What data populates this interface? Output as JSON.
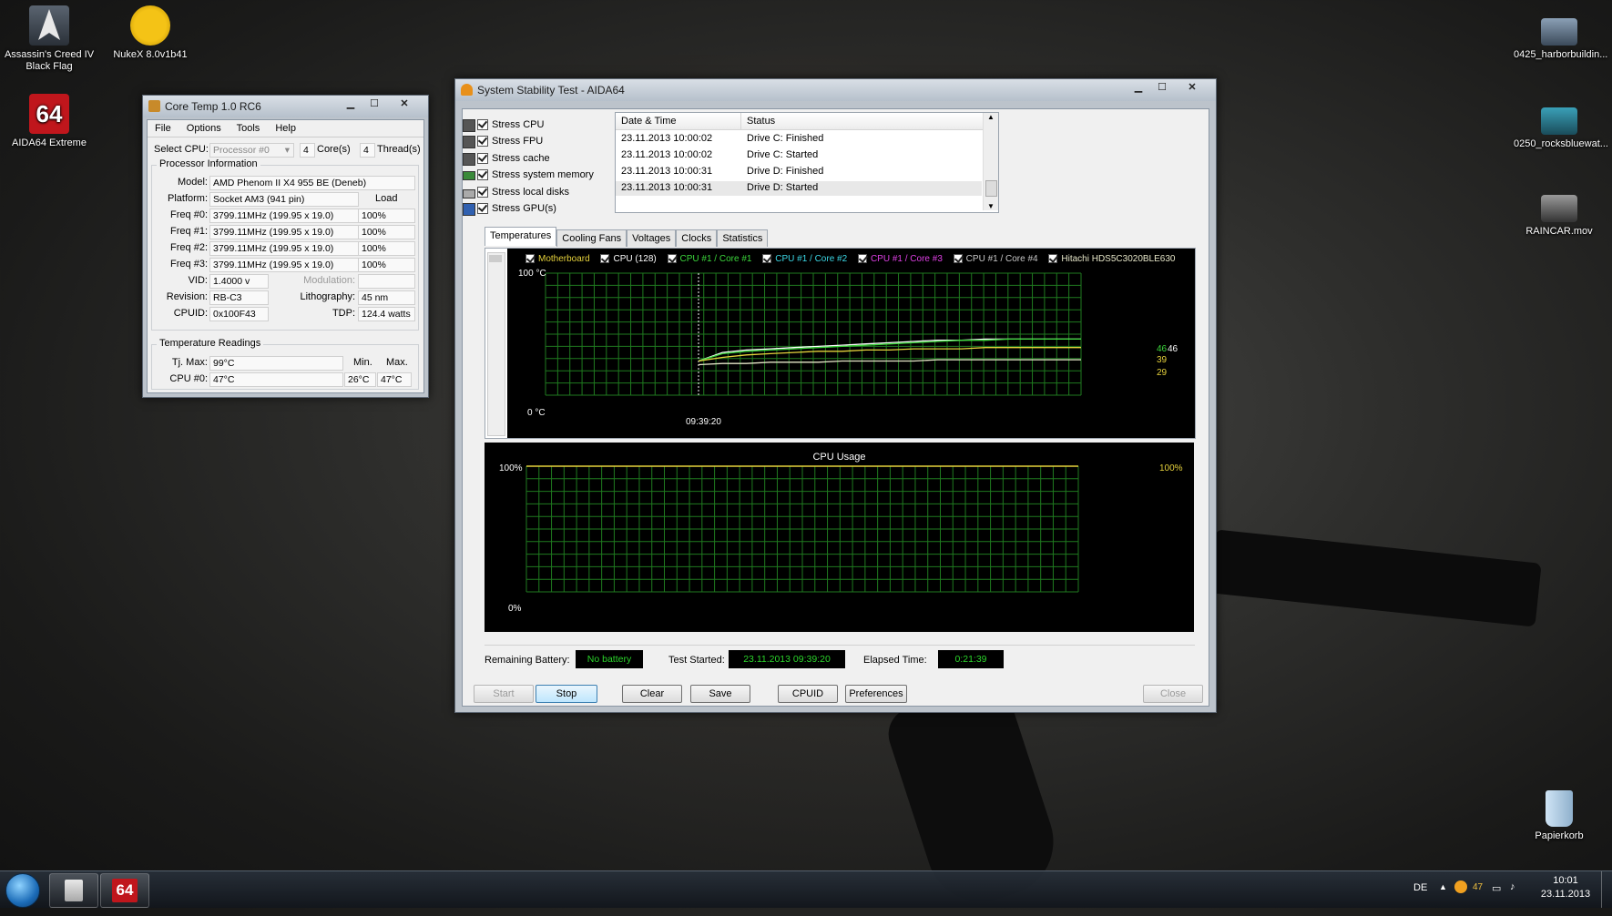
{
  "desktop": {
    "icons_left": [
      {
        "label1": "Assassin's Creed IV",
        "label2": "Black Flag"
      },
      {
        "label1": "NukeX 8.0v1b41",
        "label2": ""
      },
      {
        "label1": "AIDA64 Extreme",
        "label2": "",
        "badge": "64"
      }
    ],
    "icons_right": [
      {
        "label": "0425_harborbuildin..."
      },
      {
        "label": "0250_rocksbluewat..."
      },
      {
        "label": "RAINCAR.mov"
      },
      {
        "label": "Papierkorb"
      }
    ]
  },
  "coretemp": {
    "title": "Core Temp 1.0 RC6",
    "menu": [
      "File",
      "Options",
      "Tools",
      "Help"
    ],
    "select_cpu_label": "Select CPU:",
    "select_cpu_value": "Processor #0",
    "cores_value": "4",
    "cores_label": "Core(s)",
    "threads_value": "4",
    "threads_label": "Thread(s)",
    "proc_info_title": "Processor Information",
    "model_label": "Model:",
    "model_value": "AMD Phenom II X4 955 BE (Deneb)",
    "platform_label": "Platform:",
    "platform_value": "Socket AM3 (941 pin)",
    "load_label": "Load",
    "freqs": [
      {
        "label": "Freq #0:",
        "value": "3799.11MHz (199.95 x 19.0)",
        "load": "100%"
      },
      {
        "label": "Freq #1:",
        "value": "3799.11MHz (199.95 x 19.0)",
        "load": "100%"
      },
      {
        "label": "Freq #2:",
        "value": "3799.11MHz (199.95 x 19.0)",
        "load": "100%"
      },
      {
        "label": "Freq #3:",
        "value": "3799.11MHz (199.95 x 19.0)",
        "load": "100%"
      }
    ],
    "vid_label": "VID:",
    "vid_value": "1.4000 v",
    "modulation_label": "Modulation:",
    "revision_label": "Revision:",
    "revision_value": "RB-C3",
    "litho_label": "Lithography:",
    "litho_value": "45 nm",
    "cpuid_label": "CPUID:",
    "cpuid_value": "0x100F43",
    "tdp_label": "TDP:",
    "tdp_value": "124.4 watts",
    "temp_title": "Temperature Readings",
    "tjmax_label": "Tj. Max:",
    "tjmax_value": "99°C",
    "min_label": "Min.",
    "max_label": "Max.",
    "cpu0_label": "CPU #0:",
    "cpu0_value": "47°C",
    "cpu0_min": "26°C",
    "cpu0_max": "47°C"
  },
  "aida": {
    "title": "System Stability Test - AIDA64",
    "stress": [
      {
        "label": "Stress CPU",
        "checked": true
      },
      {
        "label": "Stress FPU",
        "checked": true
      },
      {
        "label": "Stress cache",
        "checked": true
      },
      {
        "label": "Stress system memory",
        "checked": true
      },
      {
        "label": "Stress local disks",
        "checked": true
      },
      {
        "label": "Stress GPU(s)",
        "checked": true
      }
    ],
    "log_headers": [
      "Date & Time",
      "Status"
    ],
    "log_rows": [
      {
        "time": "23.11.2013 10:00:02",
        "status": "Drive C: Finished"
      },
      {
        "time": "23.11.2013 10:00:02",
        "status": "Drive C: Started"
      },
      {
        "time": "23.11.2013 10:00:31",
        "status": "Drive D: Finished"
      },
      {
        "time": "23.11.2013 10:00:31",
        "status": "Drive D: Started"
      }
    ],
    "tabs": [
      "Temperatures",
      "Cooling Fans",
      "Voltages",
      "Clocks",
      "Statistics"
    ],
    "active_tab": "Temperatures",
    "temp_legend": [
      {
        "label": "Motherboard",
        "color": "#e6d23c"
      },
      {
        "label": "CPU (128)",
        "color": "#ffffff"
      },
      {
        "label": "CPU #1 / Core #1",
        "color": "#3cd83c"
      },
      {
        "label": "CPU #1 / Core #2",
        "color": "#3cd8e6"
      },
      {
        "label": "CPU #1 / Core #3",
        "color": "#e040e6"
      },
      {
        "label": "CPU #1 / Core #4",
        "color": "#c8c8c8"
      },
      {
        "label": "Hitachi HDS5C3020BLE630",
        "color": "#e6e6c8"
      }
    ],
    "temp_ymax_label": "100 °C",
    "temp_ymin_label": "0 °C",
    "temp_time_label": "09:39:20",
    "temp_end_labels": [
      "46",
      "46",
      "39",
      "29"
    ],
    "cpu_usage_title": "CPU Usage",
    "cpu_ymax_label": "100%",
    "cpu_ymin_label": "0%",
    "cpu_value_label": "100%",
    "remaining_battery_label": "Remaining Battery:",
    "remaining_battery_value": "No battery",
    "test_started_label": "Test Started:",
    "test_started_value": "23.11.2013 09:39:20",
    "elapsed_label": "Elapsed Time:",
    "elapsed_value": "0:21:39",
    "buttons": {
      "start": "Start",
      "stop": "Stop",
      "clear": "Clear",
      "save": "Save",
      "cpuid": "CPUID",
      "preferences": "Preferences",
      "close": "Close"
    }
  },
  "taskbar": {
    "lang": "DE",
    "tray_temp": "47",
    "time": "10:01",
    "date": "23.11.2013",
    "aida_badge": "64"
  },
  "chart_data": [
    {
      "type": "line",
      "title": "",
      "ylim": [
        0,
        100
      ],
      "x_label_at_marker": "09:39:20",
      "series": [
        {
          "name": "CPU (128)",
          "color": "#ffffff",
          "values": [
            28,
            35,
            37,
            38,
            39,
            40,
            41,
            42,
            43,
            44,
            45,
            45,
            46,
            46,
            46,
            46,
            46
          ]
        },
        {
          "name": "CPU #1 / Core #1",
          "color": "#3cd83c",
          "values": [
            28,
            34,
            36,
            37,
            38,
            39,
            40,
            41,
            42,
            43,
            44,
            45,
            45,
            46,
            46,
            46,
            46
          ]
        },
        {
          "name": "Motherboard",
          "color": "#e6d23c",
          "values": [
            28,
            31,
            33,
            34,
            35,
            36,
            36,
            37,
            37,
            38,
            38,
            38,
            39,
            39,
            39,
            39,
            39
          ]
        },
        {
          "name": "Hitachi HDS5C3020BLE630",
          "color": "#e6e6c8",
          "values": [
            25,
            26,
            26,
            27,
            27,
            27,
            28,
            28,
            28,
            28,
            29,
            29,
            29,
            29,
            29,
            29,
            29
          ]
        }
      ]
    },
    {
      "type": "line",
      "title": "CPU Usage",
      "ylim": [
        0,
        100
      ],
      "series": [
        {
          "name": "",
          "color": "#e6d23c",
          "values": [
            100,
            100
          ]
        }
      ]
    }
  ]
}
